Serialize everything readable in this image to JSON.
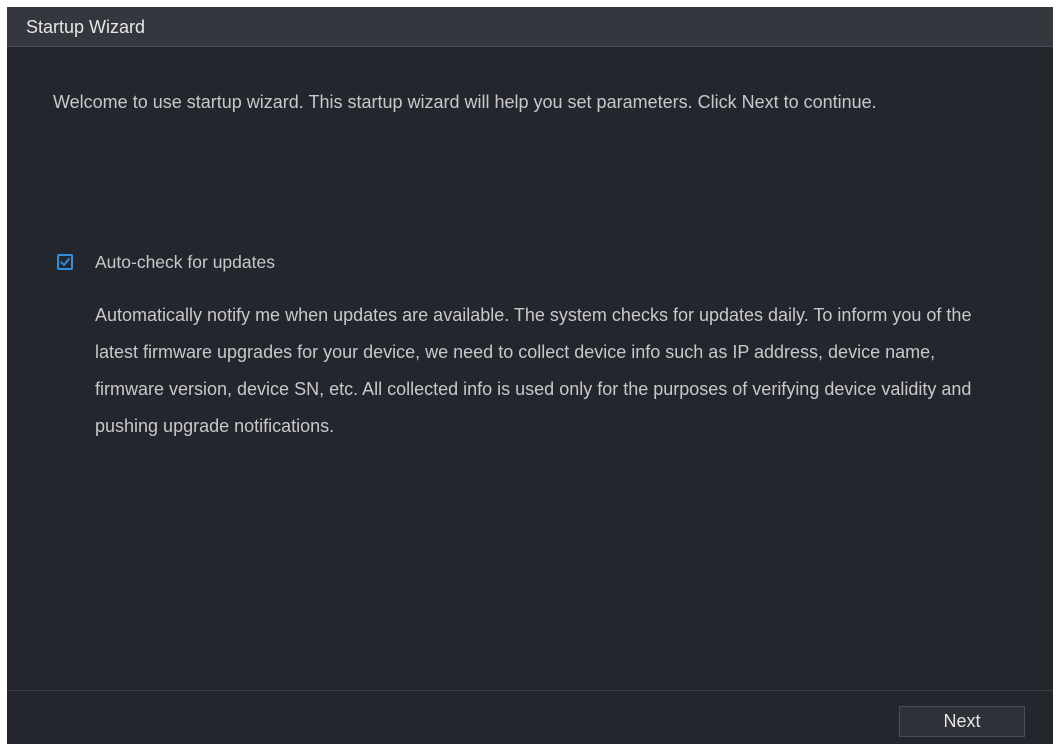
{
  "window": {
    "title": "Startup Wizard"
  },
  "main": {
    "welcome_text": "Welcome to use startup wizard. This startup wizard will help you set parameters. Click Next to continue.",
    "auto_check": {
      "label": "Auto-check for updates",
      "checked": true,
      "description": "Automatically notify me when updates are available. The system checks for updates daily. To inform you of the latest firmware upgrades for your device, we need to collect device info such as IP address, device name, firmware version, device SN, etc. All collected info is used only for the purposes of verifying device validity and pushing upgrade notifications."
    }
  },
  "footer": {
    "next_label": "Next"
  },
  "icons": {
    "checkbox": "checkmark-icon"
  },
  "colors": {
    "background": "#24262d",
    "titlebar": "#35373f",
    "accent": "#2f8fe0",
    "text": "#c8c8cc"
  }
}
